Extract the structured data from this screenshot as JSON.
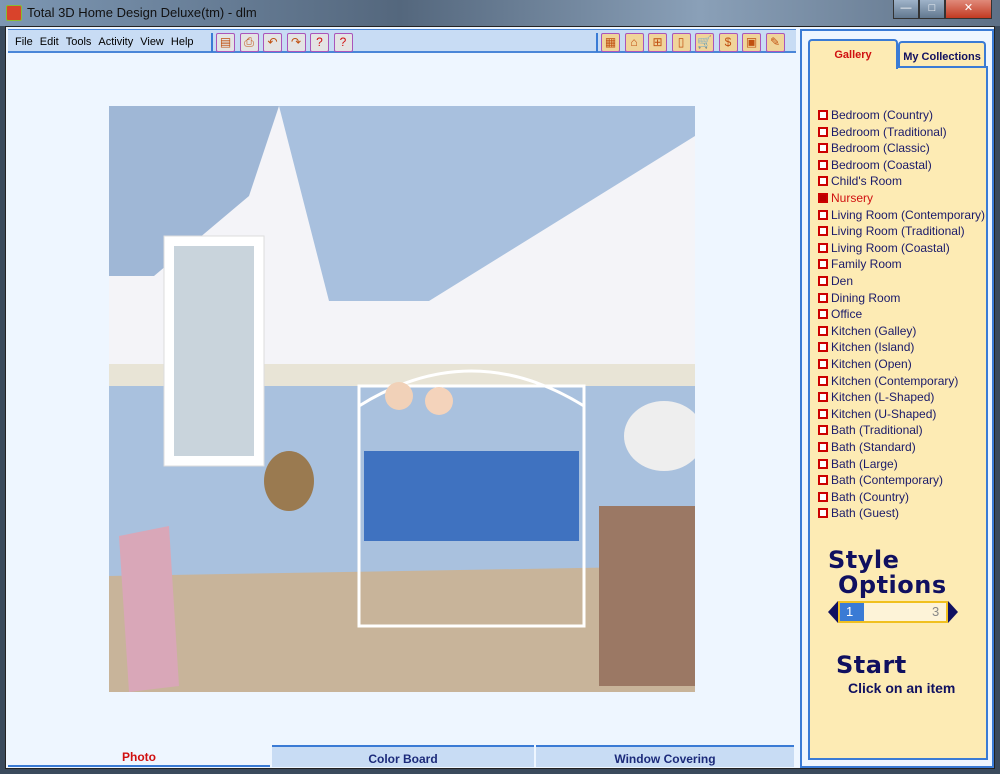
{
  "window": {
    "title": "Total 3D Home Design Deluxe(tm) - dlm",
    "minimize": "—",
    "maximize": "□",
    "close": "✕"
  },
  "menu": [
    "File",
    "Edit",
    "Tools",
    "Activity",
    "View",
    "Help"
  ],
  "toolbar_left": [
    {
      "icon": "save-icon",
      "glyph": "▤"
    },
    {
      "icon": "print-icon",
      "glyph": "⎙"
    },
    {
      "icon": "undo-icon",
      "glyph": "↶"
    },
    {
      "icon": "redo-icon",
      "glyph": "↷"
    },
    {
      "icon": "help-icon",
      "glyph": "?"
    },
    {
      "icon": "context-help-icon",
      "glyph": "?"
    }
  ],
  "toolbar_right": [
    {
      "icon": "catalog-icon",
      "glyph": "▦"
    },
    {
      "icon": "house-icon",
      "glyph": "⌂"
    },
    {
      "icon": "window-icon",
      "glyph": "⊞"
    },
    {
      "icon": "door-icon",
      "glyph": "▯"
    },
    {
      "icon": "cart-icon",
      "glyph": "🛒"
    },
    {
      "icon": "estimate-icon",
      "glyph": "$"
    },
    {
      "icon": "materials-icon",
      "glyph": "▣"
    },
    {
      "icon": "tools-icon",
      "glyph": "✎"
    }
  ],
  "bottom_tabs": [
    "Photo",
    "Color Board",
    "Window Covering"
  ],
  "side_tabs": [
    "Gallery",
    "My Collections"
  ],
  "gallery": [
    "Bedroom (Country)",
    "Bedroom (Traditional)",
    "Bedroom (Classic)",
    "Bedroom (Coastal)",
    "Child's Room",
    "Nursery",
    "Living Room (Contemporary)",
    "Living Room (Traditional)",
    "Living Room (Coastal)",
    "Family Room",
    "Den",
    "Dining Room",
    "Office",
    "Kitchen (Galley)",
    "Kitchen (Island)",
    "Kitchen (Open)",
    "Kitchen (Contemporary)",
    "Kitchen (L-Shaped)",
    "Kitchen (U-Shaped)",
    "Bath (Traditional)",
    "Bath (Standard)",
    "Bath (Large)",
    "Bath (Contemporary)",
    "Bath (Country)",
    "Bath (Guest)"
  ],
  "selected_gallery": "Nursery",
  "style_options": {
    "line1": "Style",
    "line2": "Options",
    "current": "1",
    "total": "3"
  },
  "start": {
    "title": "Start",
    "hint": "Click on an item"
  }
}
